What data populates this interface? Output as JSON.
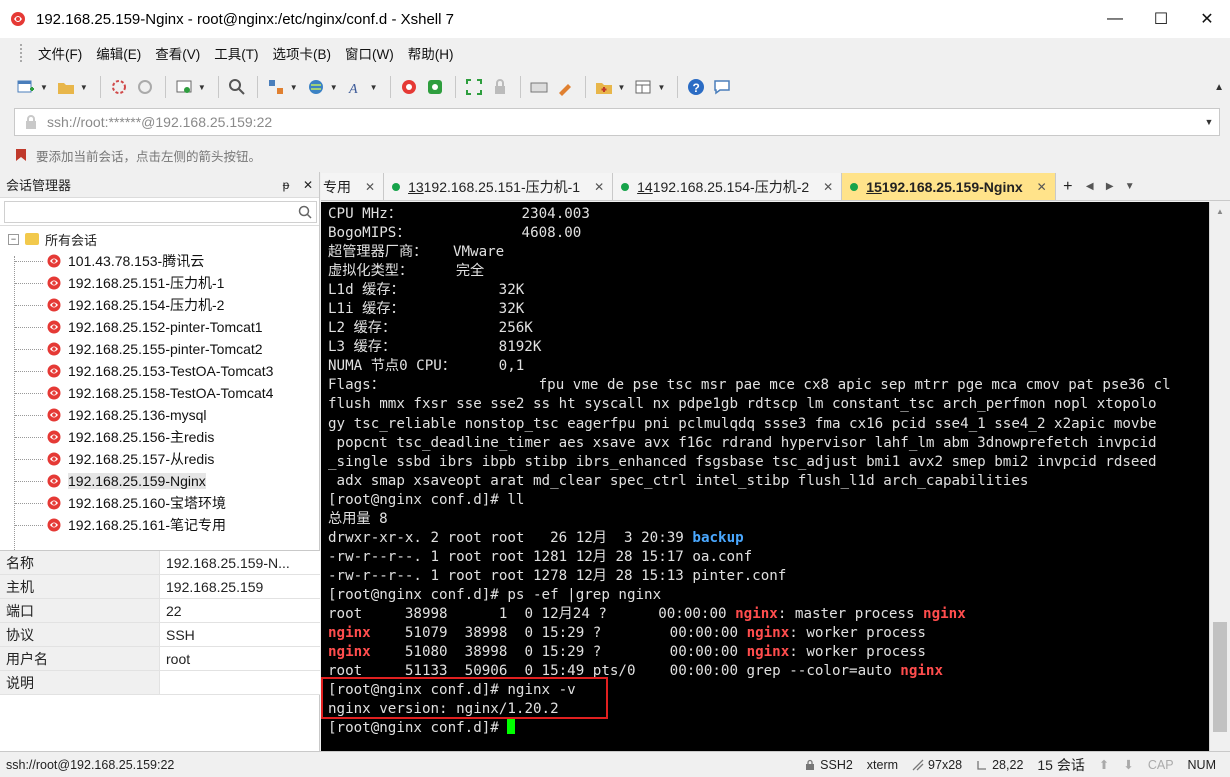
{
  "window": {
    "title": "192.168.25.159-Nginx - root@nginx:/etc/nginx/conf.d - Xshell 7",
    "minimize": "—",
    "maximize": "☐",
    "close": "✕"
  },
  "menu": [
    "文件(F)",
    "编辑(E)",
    "查看(V)",
    "工具(T)",
    "选项卡(B)",
    "窗口(W)",
    "帮助(H)"
  ],
  "address": {
    "value": "ssh://root:******@192.168.25.159:22"
  },
  "hint": {
    "text": "要添加当前会话，点击左侧的箭头按钮。"
  },
  "session_manager": {
    "title": "会话管理器",
    "pin": "ᵽ",
    "close": "✕",
    "root_label": "所有会话",
    "root_toggle": "−",
    "items": [
      "101.43.78.153-腾讯云",
      "192.168.25.151-压力机-1",
      "192.168.25.154-压力机-2",
      "192.168.25.152-pinter-Tomcat1",
      "192.168.25.155-pinter-Tomcat2",
      "192.168.25.153-TestOA-Tomcat3",
      "192.168.25.158-TestOA-Tomcat4",
      "192.168.25.136-mysql",
      "192.168.25.156-主redis",
      "192.168.25.157-从redis",
      "192.168.25.159-Nginx",
      "192.168.25.160-宝塔环境",
      "192.168.25.161-笔记专用"
    ],
    "selected_index": 10
  },
  "properties": [
    {
      "key": "名称",
      "value": "192.168.25.159-N..."
    },
    {
      "key": "主机",
      "value": "192.168.25.159"
    },
    {
      "key": "端口",
      "value": "22"
    },
    {
      "key": "协议",
      "value": "SSH"
    },
    {
      "key": "用户名",
      "value": "root"
    },
    {
      "key": "说明",
      "value": ""
    }
  ],
  "tabs": {
    "partial_label": "专用",
    "items": [
      {
        "num": "13",
        "label": " 192.168.25.151-压力机-1"
      },
      {
        "num": "14",
        "label": " 192.168.25.154-压力机-2"
      },
      {
        "num": "15",
        "label": " 192.168.25.159-Nginx"
      }
    ],
    "close": "✕",
    "add": "+",
    "prev": "◀",
    "next": "▶",
    "menu": "▼"
  },
  "terminal": {
    "lines": [
      [
        {
          "t": "CPU MHz：              2304.003"
        }
      ],
      [
        {
          "t": "BogoMIPS：             4608.00"
        }
      ],
      [
        {
          "t": "超管理器厂商：   VMware"
        }
      ],
      [
        {
          "t": "虚拟化类型：     完全"
        }
      ],
      [
        {
          "t": "L1d 缓存：           32K"
        }
      ],
      [
        {
          "t": "L1i 缓存：           32K"
        }
      ],
      [
        {
          "t": "L2 缓存：            256K"
        }
      ],
      [
        {
          "t": "L3 缓存：            8192K"
        }
      ],
      [
        {
          "t": "NUMA 节点0 CPU：     0,1"
        }
      ],
      [
        {
          "t": "Flags：                  fpu vme de pse tsc msr pae mce cx8 apic sep mtrr pge mca cmov pat pse36 cl"
        }
      ],
      [
        {
          "t": "flush mmx fxsr sse sse2 ss ht syscall nx pdpe1gb rdtscp lm constant_tsc arch_perfmon nopl xtopolo"
        }
      ],
      [
        {
          "t": "gy tsc_reliable nonstop_tsc eagerfpu pni pclmulqdq ssse3 fma cx16 pcid sse4_1 sse4_2 x2apic movbe"
        }
      ],
      [
        {
          "t": " popcnt tsc_deadline_timer aes xsave avx f16c rdrand hypervisor lahf_lm abm 3dnowprefetch invpcid"
        }
      ],
      [
        {
          "t": "_single ssbd ibrs ibpb stibp ibrs_enhanced fsgsbase tsc_adjust bmi1 avx2 smep bmi2 invpcid rdseed"
        }
      ],
      [
        {
          "t": " adx smap xsaveopt arat md_clear spec_ctrl intel_stibp flush_l1d arch_capabilities"
        }
      ],
      [
        {
          "t": "[root@nginx conf.d]# ll"
        }
      ],
      [
        {
          "t": "总用量 8"
        }
      ],
      [
        {
          "t": "drwxr-xr-x. 2 root root   26 12月  3 20:39 "
        },
        {
          "t": "backup",
          "c": "blue"
        }
      ],
      [
        {
          "t": "-rw-r--r--. 1 root root 1281 12月 28 15:17 oa.conf"
        }
      ],
      [
        {
          "t": "-rw-r--r--. 1 root root 1278 12月 28 15:13 pinter.conf"
        }
      ],
      [
        {
          "t": "[root@nginx conf.d]# ps -ef |grep nginx"
        }
      ],
      [
        {
          "t": "root     38998      1  0 12月24 ?      00:00:00 "
        },
        {
          "t": "nginx",
          "c": "red"
        },
        {
          "t": ": master process "
        },
        {
          "t": "nginx",
          "c": "red"
        }
      ],
      [
        {
          "t": "nginx",
          "c": "red"
        },
        {
          "t": "    51079  38998  0 15:29 ?        00:00:00 "
        },
        {
          "t": "nginx",
          "c": "red"
        },
        {
          "t": ": worker process"
        }
      ],
      [
        {
          "t": "nginx",
          "c": "red"
        },
        {
          "t": "    51080  38998  0 15:29 ?        00:00:00 "
        },
        {
          "t": "nginx",
          "c": "red"
        },
        {
          "t": ": worker process"
        }
      ],
      [
        {
          "t": "root     51133  50906  0 15:49 pts/0    00:00:00 grep --color=auto "
        },
        {
          "t": "nginx",
          "c": "red"
        }
      ],
      [
        {
          "t": "[root@nginx conf.d]# nginx -v"
        }
      ],
      [
        {
          "t": "nginx version: nginx/1.20.2"
        }
      ],
      [
        {
          "t": "[root@nginx conf.d]# "
        },
        {
          "cursor": true
        }
      ]
    ]
  },
  "status": {
    "left": "ssh://root@192.168.25.159:22",
    "protocol": "SSH2",
    "term": "xterm",
    "size": "97x28",
    "pos": "28,22",
    "sessions": "15 会话",
    "caps": "CAP",
    "num": "NUM"
  },
  "colors": {
    "active_tab": "#ffe38a",
    "terminal_bg": "#000000",
    "term_red": "#ff4d4d",
    "term_blue": "#4aa8ff",
    "cursor": "#00ff00",
    "highlight_box": "#e02020"
  }
}
